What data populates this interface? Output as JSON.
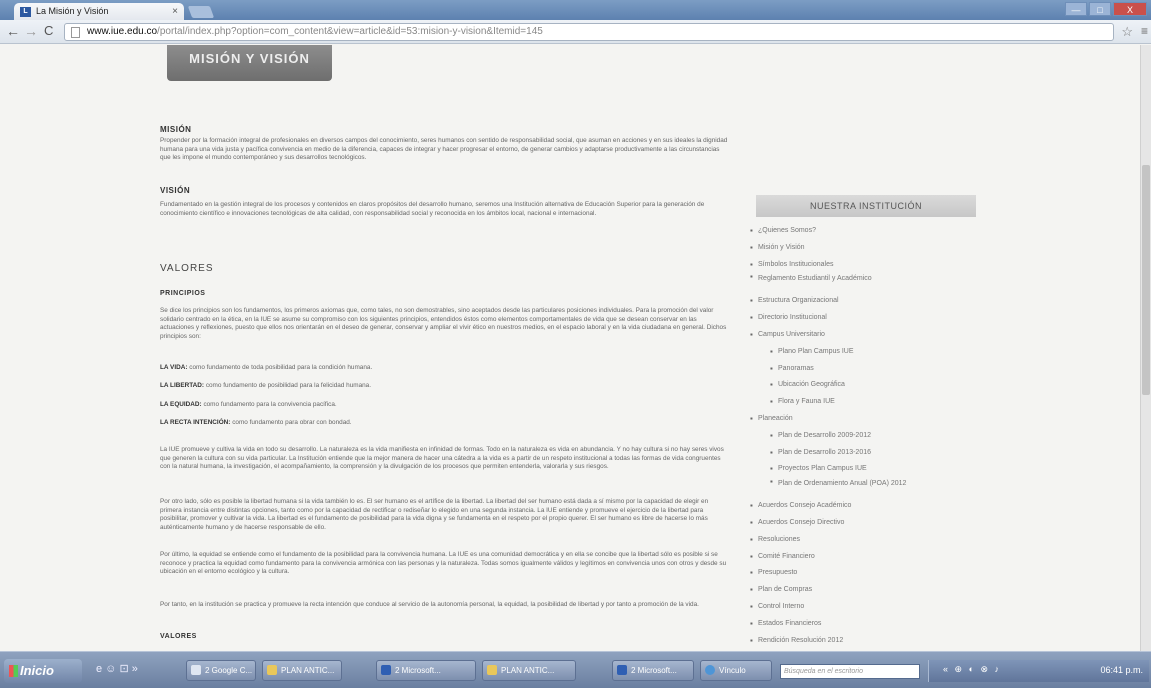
{
  "browser": {
    "tab_title": "La Misión y Visión",
    "favicon_text": "L",
    "tab_close": "×",
    "url_host": "www.iue.edu.co",
    "url_path": "/portal/index.php?option=com_content&view=article&id=53:mision-y-vision&Itemid=145",
    "nav": {
      "back": "←",
      "forward": "→",
      "reload": "C"
    },
    "window_controls": {
      "minimize": "—",
      "maximize": "□",
      "close": "X"
    },
    "star": "☆",
    "menu": "≡"
  },
  "page": {
    "banner": "MISIÓN Y VISIÓN",
    "mision_heading": "MISIÓN",
    "mision_text": "Propender por la formación integral de profesionales en diversos campos del conocimiento, seres humanos con sentido de responsabilidad social, que asuman en acciones y en sus ideales la dignidad humana para una vida justa y pacífica convivencia en medio de la diferencia, capaces de integrar y hacer progresar el entorno, de generar cambios y adaptarse productivamente a las circunstancias que les impone el mundo contemporáneo y sus desarrollos tecnológicos.",
    "vision_heading": "VISIÓN",
    "vision_text": "Fundamentado en la gestión integral de los procesos y contenidos en claros propósitos del desarrollo humano, seremos una Institución alternativa de Educación Superior para la generación de conocimiento científico e innovaciones tecnológicas de alta calidad, con responsabilidad social y reconocida en los ámbitos local, nacional e internacional.",
    "valores_heading": "VALORES",
    "principios_heading": "PRINCIPIOS",
    "principios_text": "Se dice los principios son los fundamentos, los primeros axiomas que, como tales, no son demostrables, sino aceptados desde las particulares posiciones individuales. Para la promoción del valor solidario centrado en la ética, en la IUE se asume su compromiso con los siguientes principios, entendidos éstos como elementos comportamentales de vida que se desean conservar en las actuaciones y reflexiones, puesto que ellos nos orientarán en el deseo de generar, conservar y ampliar el vivir ético en nuestros medios, en el espacio laboral y en la vida ciudadana en general. Dichos principios son:",
    "vida_label": "LA VIDA:",
    "vida_text": "como fundamento de toda posibilidad para la condición humana.",
    "libertad_label": "LA LIBERTAD:",
    "libertad_text": "como fundamento de posibilidad para la felicidad humana.",
    "equidad_label": "LA EQUIDAD:",
    "equidad_text": "como fundamento para la convivencia pacífica.",
    "recta_label": "LA RECTA INTENCIÓN:",
    "recta_text": "como fundamento para obrar con bondad.",
    "para1": "La IUE promueve y cultiva la vida en todo su desarrollo. La naturaleza es la vida manifiesta en infinidad de formas. Todo en la naturaleza es vida en abundancia. Y no hay cultura si no hay seres vivos que generen la cultura con su vida particular. La Institución entiende que la mejor manera de hacer una cátedra a la vida es a partir de un respeto institucional a todas las formas de vida congruentes con la natural humana, la investigación, el acompañamiento, la comprensión y la divulgación de los procesos que permiten entenderla, valorarla y sus riesgos.",
    "para2": "Por otro lado, sólo es posible la libertad humana si la vida también lo es. El ser humano es el artífice de la libertad. La libertad del ser humano está dada a sí mismo por la capacidad de elegir en primera instancia entre distintas opciones, tanto como por la capacidad de rectificar o rediseñar lo elegido en una segunda instancia. La IUE entiende y promueve el ejercicio de la libertad para posibilitar, promover y cultivar la vida. La libertad es el fundamento de posibilidad para la vida digna y se fundamenta en el respeto por el propio querer. El ser humano es libre de hacerse lo más auténticamente humano y de hacerse responsable de ello.",
    "para3": "Por último, la equidad se entiende como el fundamento de la posibilidad para la convivencia humana. La IUE es una comunidad democrática y en ella se concibe que la libertad sólo es posible si se reconoce y practica la equidad como fundamento para la convivencia armónica con las personas y la naturaleza. Todas somos igualmente válidos y legítimos en convivencia unos con otros y desde su ubicación en el entorno ecológico y la cultura.",
    "para4": "Por tanto, en la institución se practica y promueve la recta intención que conduce al servicio de la autonomía personal, la equidad, la posibilidad de libertad y por tanto a promoción de la vida.",
    "valores_bottom": "VALORES"
  },
  "sidebar": {
    "title": "NUESTRA INSTITUCIÓN",
    "bullet": "▪",
    "items": [
      {
        "label": "¿Quienes Somos?",
        "level": 0
      },
      {
        "label": "Misión y Visión",
        "level": 0
      },
      {
        "label": "Símbolos Institucionales",
        "level": 0
      },
      {
        "label": "Reglamento Estudiantil y Académico",
        "level": 0
      },
      {
        "label": "Estructura Organizacional",
        "level": 0
      },
      {
        "label": "Directorio Institucional",
        "level": 0
      },
      {
        "label": "Campus Universitario",
        "level": 0
      },
      {
        "label": "Plano Plan Campus IUE",
        "level": 1
      },
      {
        "label": "Panoramas",
        "level": 1
      },
      {
        "label": "Ubicación Geográfica",
        "level": 1
      },
      {
        "label": "Flora y Fauna IUE",
        "level": 1
      },
      {
        "label": "Planeación",
        "level": 0
      },
      {
        "label": "Plan de Desarrollo 2009-2012",
        "level": 1
      },
      {
        "label": "Plan de Desarrollo 2013-2016",
        "level": 1
      },
      {
        "label": "Proyectos Plan Campus IUE",
        "level": 1
      },
      {
        "label": "Plan de Ordenamiento Anual (POA) 2012",
        "level": 1
      },
      {
        "label": "Acuerdos Consejo Académico",
        "level": 0
      },
      {
        "label": "Acuerdos Consejo Directivo",
        "level": 0
      },
      {
        "label": "Resoluciones",
        "level": 0
      },
      {
        "label": "Comité Financiero",
        "level": 0
      },
      {
        "label": "Presupuesto",
        "level": 0
      },
      {
        "label": "Plan de Compras",
        "level": 0
      },
      {
        "label": "Control Interno",
        "level": 0
      },
      {
        "label": "Estados Financieros",
        "level": 0
      },
      {
        "label": "Rendición Resolución 2012",
        "level": 0
      }
    ]
  },
  "taskbar": {
    "start_label": "Inicio",
    "quicklaunch": "e  ☺  ⊡  »",
    "buttons": [
      {
        "label": "2 Google C...",
        "icon": "chrome"
      },
      {
        "label": "PLAN ANTIC...",
        "icon": "folder"
      },
      {
        "label": "2 Microsoft...",
        "icon": "word"
      },
      {
        "label": "PLAN ANTIC...",
        "icon": "folder"
      },
      {
        "label": "2 Microsoft...",
        "icon": "word"
      },
      {
        "label": "Vínculo",
        "icon": "ie"
      }
    ],
    "search_placeholder": "Búsqueda en el escritorio",
    "tray_icons": "« ⊕ ◐ ⊗ ♪",
    "clock": "06:41 p.m."
  }
}
